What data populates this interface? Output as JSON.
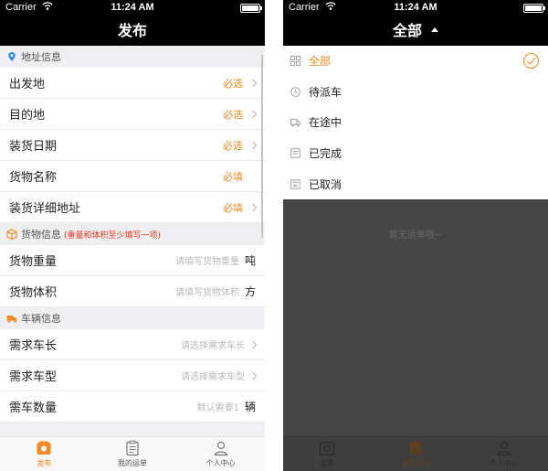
{
  "status_bar": {
    "carrier": "Carrier",
    "time": "11:24 AM"
  },
  "left": {
    "title": "发布",
    "sections": {
      "address": {
        "header": "地址信息",
        "rows": [
          {
            "label": "出发地",
            "status": "必选"
          },
          {
            "label": "目的地",
            "status": "必选"
          },
          {
            "label": "装货日期",
            "status": "必选"
          },
          {
            "label": "货物名称",
            "status": "必填"
          },
          {
            "label": "装货详细地址",
            "status": "必填"
          }
        ]
      },
      "goods": {
        "header": "货物信息",
        "note": "(重量和体积至少填写一项)",
        "rows": [
          {
            "label": "货物重量",
            "placeholder": "请填写货物重量",
            "unit": "吨"
          },
          {
            "label": "货物体积",
            "placeholder": "请填写货物体积",
            "unit": "方"
          }
        ]
      },
      "vehicle": {
        "header": "车辆信息",
        "rows": [
          {
            "label": "需求车长",
            "placeholder": "请选择需求车长"
          },
          {
            "label": "需求车型",
            "placeholder": "请选择需求车型"
          },
          {
            "label": "需车数量",
            "placeholder": "默认需要1",
            "unit": "辆"
          }
        ]
      }
    },
    "tabs": [
      "发布",
      "我的运单",
      "个人中心"
    ]
  },
  "right": {
    "title": "全部",
    "filters": [
      "全部",
      "待派车",
      "在途中",
      "已完成",
      "已取消"
    ],
    "empty_text": "暂无运单哦~",
    "tabs": [
      "发布",
      "我的运单",
      "个人中心"
    ]
  },
  "colors": {
    "accent": "#f08a24",
    "note_red": "#e4361c",
    "bar": "#000000"
  }
}
